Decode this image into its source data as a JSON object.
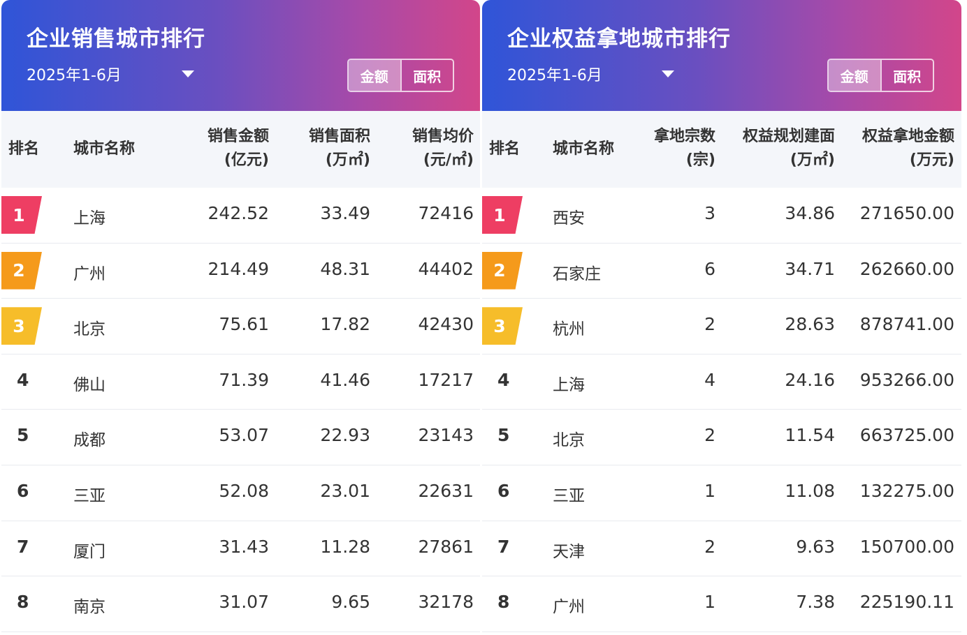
{
  "left": {
    "title": "企业销售城市排行",
    "period": "2025年1-6月",
    "toggle": {
      "amount_label": "金额",
      "area_label": "面积",
      "active": "amount"
    },
    "columns": {
      "rank": "排名",
      "city": "城市名称",
      "col1": [
        "销售金额",
        "(亿元)"
      ],
      "col2": [
        "销售面积",
        "(万㎡)"
      ],
      "col3": [
        "销售均价",
        "(元/㎡)"
      ]
    },
    "rows": [
      {
        "rank": "1",
        "city": "上海",
        "v1": "242.52",
        "v2": "33.49",
        "v3": "72416"
      },
      {
        "rank": "2",
        "city": "广州",
        "v1": "214.49",
        "v2": "48.31",
        "v3": "44402"
      },
      {
        "rank": "3",
        "city": "北京",
        "v1": "75.61",
        "v2": "17.82",
        "v3": "42430"
      },
      {
        "rank": "4",
        "city": "佛山",
        "v1": "71.39",
        "v2": "41.46",
        "v3": "17217"
      },
      {
        "rank": "5",
        "city": "成都",
        "v1": "53.07",
        "v2": "22.93",
        "v3": "23143"
      },
      {
        "rank": "6",
        "city": "三亚",
        "v1": "52.08",
        "v2": "23.01",
        "v3": "22631"
      },
      {
        "rank": "7",
        "city": "厦门",
        "v1": "31.43",
        "v2": "11.28",
        "v3": "27861"
      },
      {
        "rank": "8",
        "city": "南京",
        "v1": "31.07",
        "v2": "9.65",
        "v3": "32178"
      }
    ]
  },
  "right": {
    "title": "企业权益拿地城市排行",
    "period": "2025年1-6月",
    "toggle": {
      "amount_label": "金额",
      "area_label": "面积",
      "active": "amount"
    },
    "columns": {
      "rank": "排名",
      "city": "城市名称",
      "col1": [
        "拿地宗数",
        "(宗)"
      ],
      "col2": [
        "权益规划建面",
        "(万㎡)"
      ],
      "col3": [
        "权益拿地金额",
        "(万元)"
      ]
    },
    "rows": [
      {
        "rank": "1",
        "city": "西安",
        "v1": "3",
        "v2": "34.86",
        "v3": "271650.00"
      },
      {
        "rank": "2",
        "city": "石家庄",
        "v1": "6",
        "v2": "34.71",
        "v3": "262660.00"
      },
      {
        "rank": "3",
        "city": "杭州",
        "v1": "2",
        "v2": "28.63",
        "v3": "878741.00"
      },
      {
        "rank": "4",
        "city": "上海",
        "v1": "4",
        "v2": "24.16",
        "v3": "953266.00"
      },
      {
        "rank": "5",
        "city": "北京",
        "v1": "2",
        "v2": "11.54",
        "v3": "663725.00"
      },
      {
        "rank": "6",
        "city": "三亚",
        "v1": "1",
        "v2": "11.08",
        "v3": "132275.00"
      },
      {
        "rank": "7",
        "city": "天津",
        "v1": "2",
        "v2": "9.63",
        "v3": "150700.00"
      },
      {
        "rank": "8",
        "city": "广州",
        "v1": "1",
        "v2": "7.38",
        "v3": "225190.11"
      }
    ]
  },
  "colors": {
    "rank1": "#ee3e63",
    "rank2": "#f59a1b",
    "rank3": "#f6bd2a",
    "header_gradient_start": "#2f55d8",
    "header_gradient_end": "#d2468a"
  },
  "icons": {
    "period_dropdown": "caret-down-icon"
  }
}
